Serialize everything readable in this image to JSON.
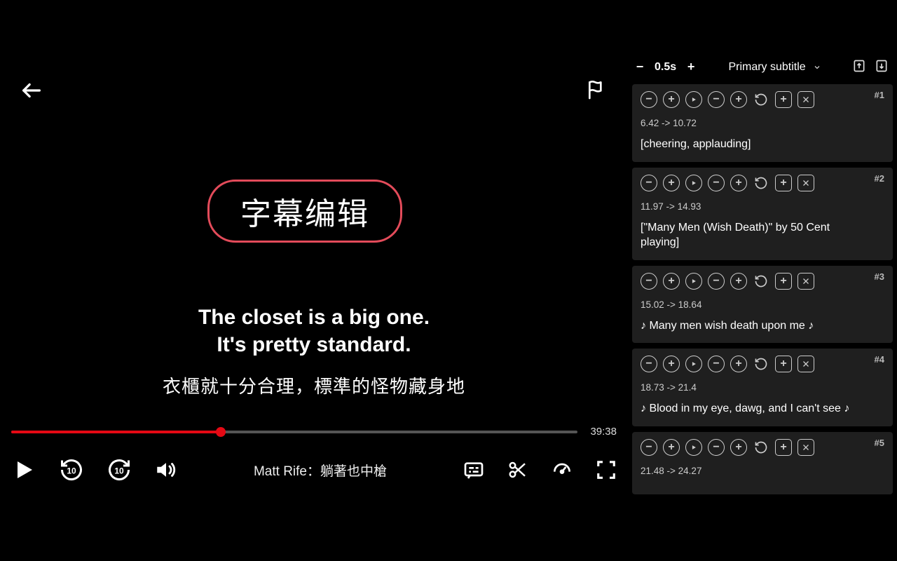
{
  "badge_label": "字幕编辑",
  "subtitle_primary_line1": "The closet is a big one.",
  "subtitle_primary_line2": "It's pretty standard.",
  "subtitle_secondary": "衣櫃就十分合理，標準的怪物藏身地",
  "progress": {
    "percent": 37,
    "total_time": "39:38"
  },
  "video_title": "Matt Rife：躺著也中槍",
  "panel": {
    "step_value": "0.5s",
    "dropdown_label": "Primary subtitle",
    "cues": [
      {
        "idx": "#1",
        "start": "6.42",
        "end": "10.72",
        "text": "[cheering, applauding]"
      },
      {
        "idx": "#2",
        "start": "11.97",
        "end": "14.93",
        "text": "[\"Many Men (Wish Death)\" by 50 Cent<br>playing]"
      },
      {
        "idx": "#3",
        "start": "15.02",
        "end": "18.64",
        "text": "♪ Many men wish death upon me ♪"
      },
      {
        "idx": "#4",
        "start": "18.73",
        "end": "21.4",
        "text": "♪ Blood in my eye, dawg, and I can't see ♪"
      },
      {
        "idx": "#5",
        "start": "21.48",
        "end": "24.27",
        "text": ""
      }
    ]
  }
}
